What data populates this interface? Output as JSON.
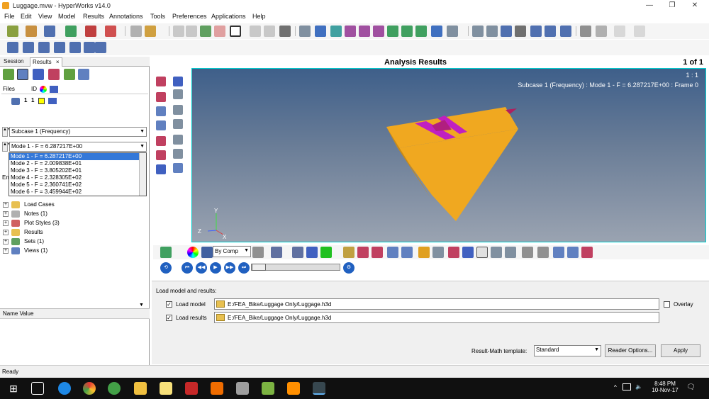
{
  "window": {
    "title": "Luggage.mvw - HyperWorks v14.0",
    "minimize": "—",
    "maximize": "❐",
    "close": "✕"
  },
  "menu": [
    "File",
    "Edit",
    "View",
    "Model",
    "Results",
    "Annotations",
    "Tools",
    "Preferences",
    "Applications",
    "Help"
  ],
  "panel": {
    "tabs": [
      {
        "label": "Session"
      },
      {
        "label": "Results",
        "close": "×"
      }
    ],
    "files_header": {
      "files": "Files",
      "id": "ID"
    },
    "file_row": {
      "index": "1",
      "id": "1"
    },
    "subcase": "Subcase 1 (Frequency)",
    "mode_selected": "Mode 1 - F = 6.287217E+00",
    "modes": [
      "Mode 1 - F = 6.287217E+00",
      "Mode 2 - F = 2.009838E+01",
      "Mode 3 - F = 3.805202E+01",
      "Mode 4 - F = 2.328305E+02",
      "Mode 5 - F = 2.360741E+02",
      "Mode 6 - F = 3.459944E+02"
    ],
    "tree_partial": "En",
    "tree": [
      {
        "label": "Load Cases",
        "icon": "folder-icon",
        "color": "#e8c050"
      },
      {
        "label": "Notes (1)",
        "icon": "notes-icon",
        "color": "#b0b0b0"
      },
      {
        "label": "Plot Styles (3)",
        "icon": "plot-style-icon",
        "color": "#d06060"
      },
      {
        "label": "Results",
        "icon": "folder-icon",
        "color": "#e8c050"
      },
      {
        "label": "Sets  (1)",
        "icon": "sets-icon",
        "color": "#60a060"
      },
      {
        "label": "Views (1)",
        "icon": "views-icon",
        "color": "#6080c0"
      }
    ],
    "name_value_header": "Name Value"
  },
  "results": {
    "title": "Analysis Results",
    "page": "1 of 1",
    "window_index": "1 : 1",
    "subtitle": "Subcase 1 (Frequency) : Mode 1 - F = 6.287217E+00 : Frame 0",
    "axis_x": "X",
    "axis_y": "Y",
    "axis_z": "Z"
  },
  "anim": {
    "by_comp": "By Comp"
  },
  "load": {
    "heading": "Load model and results:",
    "load_model_label": "Load model",
    "load_results_label": "Load results",
    "model_path": "E:/FEA_Bike/Luggage Only/Luggage.h3d",
    "results_path": "E:/FEA_Bike/Luggage Only/Luggage.h3d",
    "overlay_label": "Overlay",
    "template_label": "Result-Math template:",
    "template_value": "Standard",
    "reader_options": "Reader Options...",
    "apply": "Apply",
    "check": "✓"
  },
  "status": "Ready",
  "taskbar": {
    "time": "8:48 PM",
    "date": "10-Nov-17",
    "tray_arrow": "^",
    "volume": "🔈",
    "notification": "🗨",
    "active_app": "HyperView"
  },
  "colors": {
    "model": "#f0a820",
    "model_shade": "#c88a18",
    "highlight": "#c020c0",
    "viewport_top": "#3e5f8a",
    "selection": "#3478d8"
  }
}
